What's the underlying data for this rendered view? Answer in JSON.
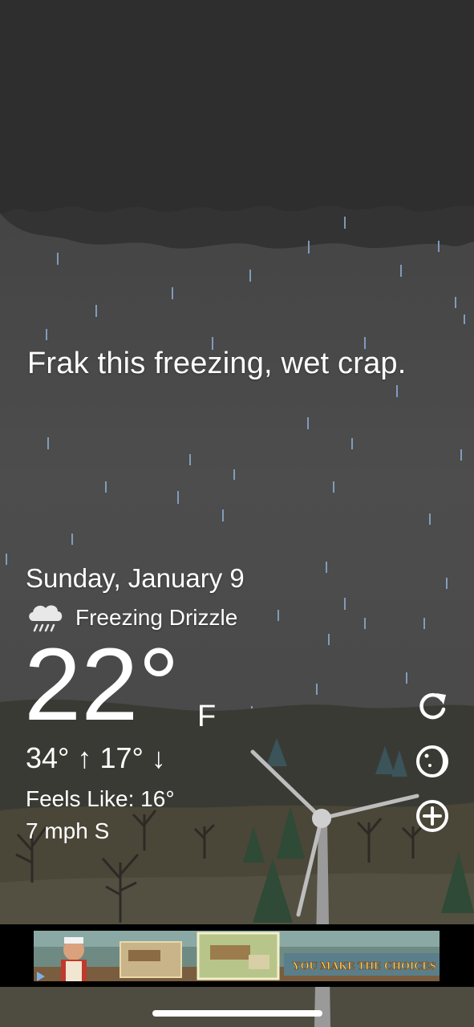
{
  "headline": "Frak this freezing, wet crap.",
  "date": "Sunday, January 9",
  "condition": {
    "label": "Freezing Drizzle",
    "icon": "freezing-drizzle-icon"
  },
  "temperature": {
    "value": "22°",
    "unit": "F"
  },
  "high_low": "34° ↑  17° ↓",
  "feels_like": "Feels Like: 16°",
  "wind": "7 mph S",
  "actions": [
    {
      "name": "refresh-icon"
    },
    {
      "name": "moon-phase-icon"
    },
    {
      "name": "add-icon"
    }
  ],
  "ad": {
    "slogan": "YOU MAKE THE CHOICES"
  },
  "colors": {
    "sky": "#444444",
    "cloud": "#2b2b2b",
    "rain": "#8fb0d8",
    "hills": "#3a3a34",
    "ground": "#504c40"
  }
}
